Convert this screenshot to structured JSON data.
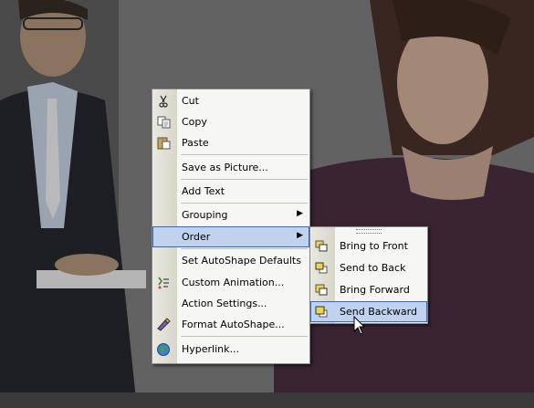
{
  "context_menu": {
    "items": [
      {
        "label": "Cut",
        "icon": "scissors-icon"
      },
      {
        "label": "Copy",
        "icon": "copy-icon"
      },
      {
        "label": "Paste",
        "icon": "paste-icon"
      },
      {
        "label": "Save as Picture...",
        "icon": null
      },
      {
        "label": "Add Text",
        "icon": null
      },
      {
        "label": "Grouping",
        "icon": null,
        "submenu": true
      },
      {
        "label": "Order",
        "icon": null,
        "submenu": true,
        "highlighted": true
      },
      {
        "label": "Set AutoShape Defaults",
        "icon": null
      },
      {
        "label": "Custom Animation...",
        "icon": "custom-animation-icon"
      },
      {
        "label": "Action Settings...",
        "icon": null
      },
      {
        "label": "Format AutoShape...",
        "icon": "format-autoshape-icon"
      },
      {
        "label": "Hyperlink...",
        "icon": "hyperlink-globe-icon"
      }
    ]
  },
  "order_submenu": {
    "items": [
      {
        "label": "Bring to Front",
        "icon": "bring-to-front-icon"
      },
      {
        "label": "Send to Back",
        "icon": "send-to-back-icon"
      },
      {
        "label": "Bring Forward",
        "icon": "bring-forward-icon"
      },
      {
        "label": "Send Backward",
        "icon": "send-backward-icon",
        "highlighted": true
      }
    ]
  },
  "colors": {
    "highlight_fill": "#c1d2ee",
    "highlight_border": "#316ac5",
    "menu_bg": "#f6f6f4"
  }
}
